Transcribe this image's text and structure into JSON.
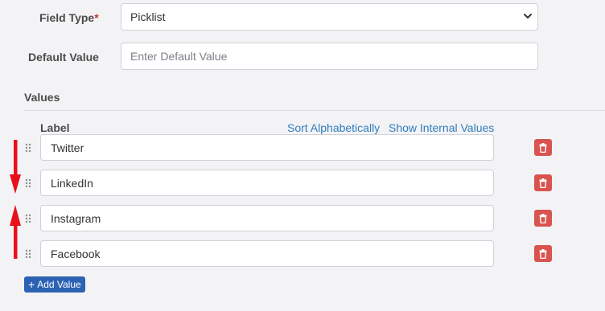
{
  "field_type": {
    "label": "Field Type",
    "required_mark": "*",
    "value": "Picklist"
  },
  "default_value": {
    "label": "Default Value",
    "placeholder": "Enter Default Value"
  },
  "values_section": {
    "title": "Values",
    "column_label": "Label",
    "sort_link": "Sort Alphabetically",
    "internal_link": "Show Internal Values",
    "items": [
      {
        "label": "Twitter"
      },
      {
        "label": "LinkedIn"
      },
      {
        "label": "Instagram"
      },
      {
        "label": "Facebook"
      }
    ],
    "add_button": "Add Value",
    "add_icon": "+"
  },
  "colors": {
    "delete": "#d9534f",
    "accent": "#2c62b4",
    "link": "#2f7dbb",
    "annotation_arrow": "#e8101b"
  },
  "icons": [
    "chevron-down-icon",
    "drag-handle-icon",
    "trash-icon",
    "plus-icon",
    "arrow-down-icon",
    "arrow-up-icon"
  ]
}
